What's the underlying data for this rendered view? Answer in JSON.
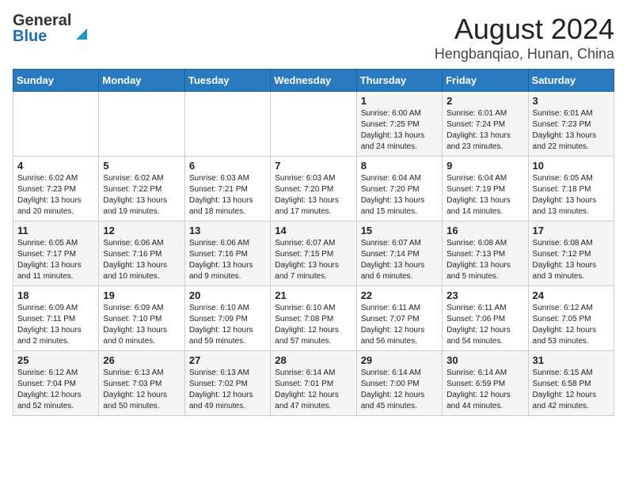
{
  "logo": {
    "line1": "General",
    "line2": "Blue"
  },
  "title": "August 2024",
  "subtitle": "Hengbanqiao, Hunan, China",
  "days_of_week": [
    "Sunday",
    "Monday",
    "Tuesday",
    "Wednesday",
    "Thursday",
    "Friday",
    "Saturday"
  ],
  "weeks": [
    [
      {
        "day": "",
        "text": ""
      },
      {
        "day": "",
        "text": ""
      },
      {
        "day": "",
        "text": ""
      },
      {
        "day": "",
        "text": ""
      },
      {
        "day": "1",
        "text": "Sunrise: 6:00 AM\nSunset: 7:25 PM\nDaylight: 13 hours\nand 24 minutes."
      },
      {
        "day": "2",
        "text": "Sunrise: 6:01 AM\nSunset: 7:24 PM\nDaylight: 13 hours\nand 23 minutes."
      },
      {
        "day": "3",
        "text": "Sunrise: 6:01 AM\nSunset: 7:23 PM\nDaylight: 13 hours\nand 22 minutes."
      }
    ],
    [
      {
        "day": "4",
        "text": "Sunrise: 6:02 AM\nSunset: 7:23 PM\nDaylight: 13 hours\nand 20 minutes."
      },
      {
        "day": "5",
        "text": "Sunrise: 6:02 AM\nSunset: 7:22 PM\nDaylight: 13 hours\nand 19 minutes."
      },
      {
        "day": "6",
        "text": "Sunrise: 6:03 AM\nSunset: 7:21 PM\nDaylight: 13 hours\nand 18 minutes."
      },
      {
        "day": "7",
        "text": "Sunrise: 6:03 AM\nSunset: 7:20 PM\nDaylight: 13 hours\nand 17 minutes."
      },
      {
        "day": "8",
        "text": "Sunrise: 6:04 AM\nSunset: 7:20 PM\nDaylight: 13 hours\nand 15 minutes."
      },
      {
        "day": "9",
        "text": "Sunrise: 6:04 AM\nSunset: 7:19 PM\nDaylight: 13 hours\nand 14 minutes."
      },
      {
        "day": "10",
        "text": "Sunrise: 6:05 AM\nSunset: 7:18 PM\nDaylight: 13 hours\nand 13 minutes."
      }
    ],
    [
      {
        "day": "11",
        "text": "Sunrise: 6:05 AM\nSunset: 7:17 PM\nDaylight: 13 hours\nand 11 minutes."
      },
      {
        "day": "12",
        "text": "Sunrise: 6:06 AM\nSunset: 7:16 PM\nDaylight: 13 hours\nand 10 minutes."
      },
      {
        "day": "13",
        "text": "Sunrise: 6:06 AM\nSunset: 7:16 PM\nDaylight: 13 hours\nand 9 minutes."
      },
      {
        "day": "14",
        "text": "Sunrise: 6:07 AM\nSunset: 7:15 PM\nDaylight: 13 hours\nand 7 minutes."
      },
      {
        "day": "15",
        "text": "Sunrise: 6:07 AM\nSunset: 7:14 PM\nDaylight: 13 hours\nand 6 minutes."
      },
      {
        "day": "16",
        "text": "Sunrise: 6:08 AM\nSunset: 7:13 PM\nDaylight: 13 hours\nand 5 minutes."
      },
      {
        "day": "17",
        "text": "Sunrise: 6:08 AM\nSunset: 7:12 PM\nDaylight: 13 hours\nand 3 minutes."
      }
    ],
    [
      {
        "day": "18",
        "text": "Sunrise: 6:09 AM\nSunset: 7:11 PM\nDaylight: 13 hours\nand 2 minutes."
      },
      {
        "day": "19",
        "text": "Sunrise: 6:09 AM\nSunset: 7:10 PM\nDaylight: 13 hours\nand 0 minutes."
      },
      {
        "day": "20",
        "text": "Sunrise: 6:10 AM\nSunset: 7:09 PM\nDaylight: 12 hours\nand 59 minutes."
      },
      {
        "day": "21",
        "text": "Sunrise: 6:10 AM\nSunset: 7:08 PM\nDaylight: 12 hours\nand 57 minutes."
      },
      {
        "day": "22",
        "text": "Sunrise: 6:11 AM\nSunset: 7:07 PM\nDaylight: 12 hours\nand 56 minutes."
      },
      {
        "day": "23",
        "text": "Sunrise: 6:11 AM\nSunset: 7:06 PM\nDaylight: 12 hours\nand 54 minutes."
      },
      {
        "day": "24",
        "text": "Sunrise: 6:12 AM\nSunset: 7:05 PM\nDaylight: 12 hours\nand 53 minutes."
      }
    ],
    [
      {
        "day": "25",
        "text": "Sunrise: 6:12 AM\nSunset: 7:04 PM\nDaylight: 12 hours\nand 52 minutes."
      },
      {
        "day": "26",
        "text": "Sunrise: 6:13 AM\nSunset: 7:03 PM\nDaylight: 12 hours\nand 50 minutes."
      },
      {
        "day": "27",
        "text": "Sunrise: 6:13 AM\nSunset: 7:02 PM\nDaylight: 12 hours\nand 49 minutes."
      },
      {
        "day": "28",
        "text": "Sunrise: 6:14 AM\nSunset: 7:01 PM\nDaylight: 12 hours\nand 47 minutes."
      },
      {
        "day": "29",
        "text": "Sunrise: 6:14 AM\nSunset: 7:00 PM\nDaylight: 12 hours\nand 45 minutes."
      },
      {
        "day": "30",
        "text": "Sunrise: 6:14 AM\nSunset: 6:59 PM\nDaylight: 12 hours\nand 44 minutes."
      },
      {
        "day": "31",
        "text": "Sunrise: 6:15 AM\nSunset: 6:58 PM\nDaylight: 12 hours\nand 42 minutes."
      }
    ]
  ]
}
